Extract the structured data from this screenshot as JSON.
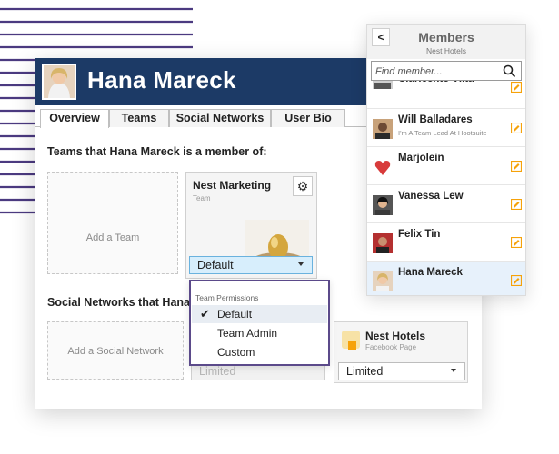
{
  "profile": {
    "name": "Hana Mareck",
    "tabs": [
      "Overview",
      "Teams",
      "Social Networks",
      "User Bio"
    ],
    "teams_title": "Teams that Hana Mareck is a member of:",
    "social_title": "Social Networks that Hana Ma",
    "add_team": "Add a Team",
    "add_social": "Add a Social Network"
  },
  "team_card": {
    "name": "Nest Marketing",
    "subtitle": "Team",
    "permission_value": "Default"
  },
  "permissions_dropdown": {
    "header": "Team Permissions",
    "options": [
      "Default",
      "Team Admin",
      "Custom"
    ],
    "selected": "Default"
  },
  "social_panel": {
    "name": "Nest Hotels",
    "subtitle": "Facebook Page",
    "value": "Limited",
    "disabled_value": "Limited"
  },
  "members_panel": {
    "title": "Members",
    "subtitle": "Nest Hotels",
    "search_placeholder": "Find member...",
    "partial_member_name": "Claricento Vilta",
    "members": [
      {
        "name": "Will Balladares",
        "role": "I'm A Team Lead At Hootsuite"
      },
      {
        "name": "Marjolein",
        "role": ""
      },
      {
        "name": "Vanessa Lew",
        "role": ""
      },
      {
        "name": "Felix Tin",
        "role": ""
      },
      {
        "name": "Hana Mareck",
        "role": ""
      }
    ]
  },
  "colors": {
    "header_navy": "#1c3a66",
    "stripe_purple": "#4b3a80",
    "select_highlight": "#d7eefc",
    "edit_icon_orange": "#f6a20a"
  }
}
